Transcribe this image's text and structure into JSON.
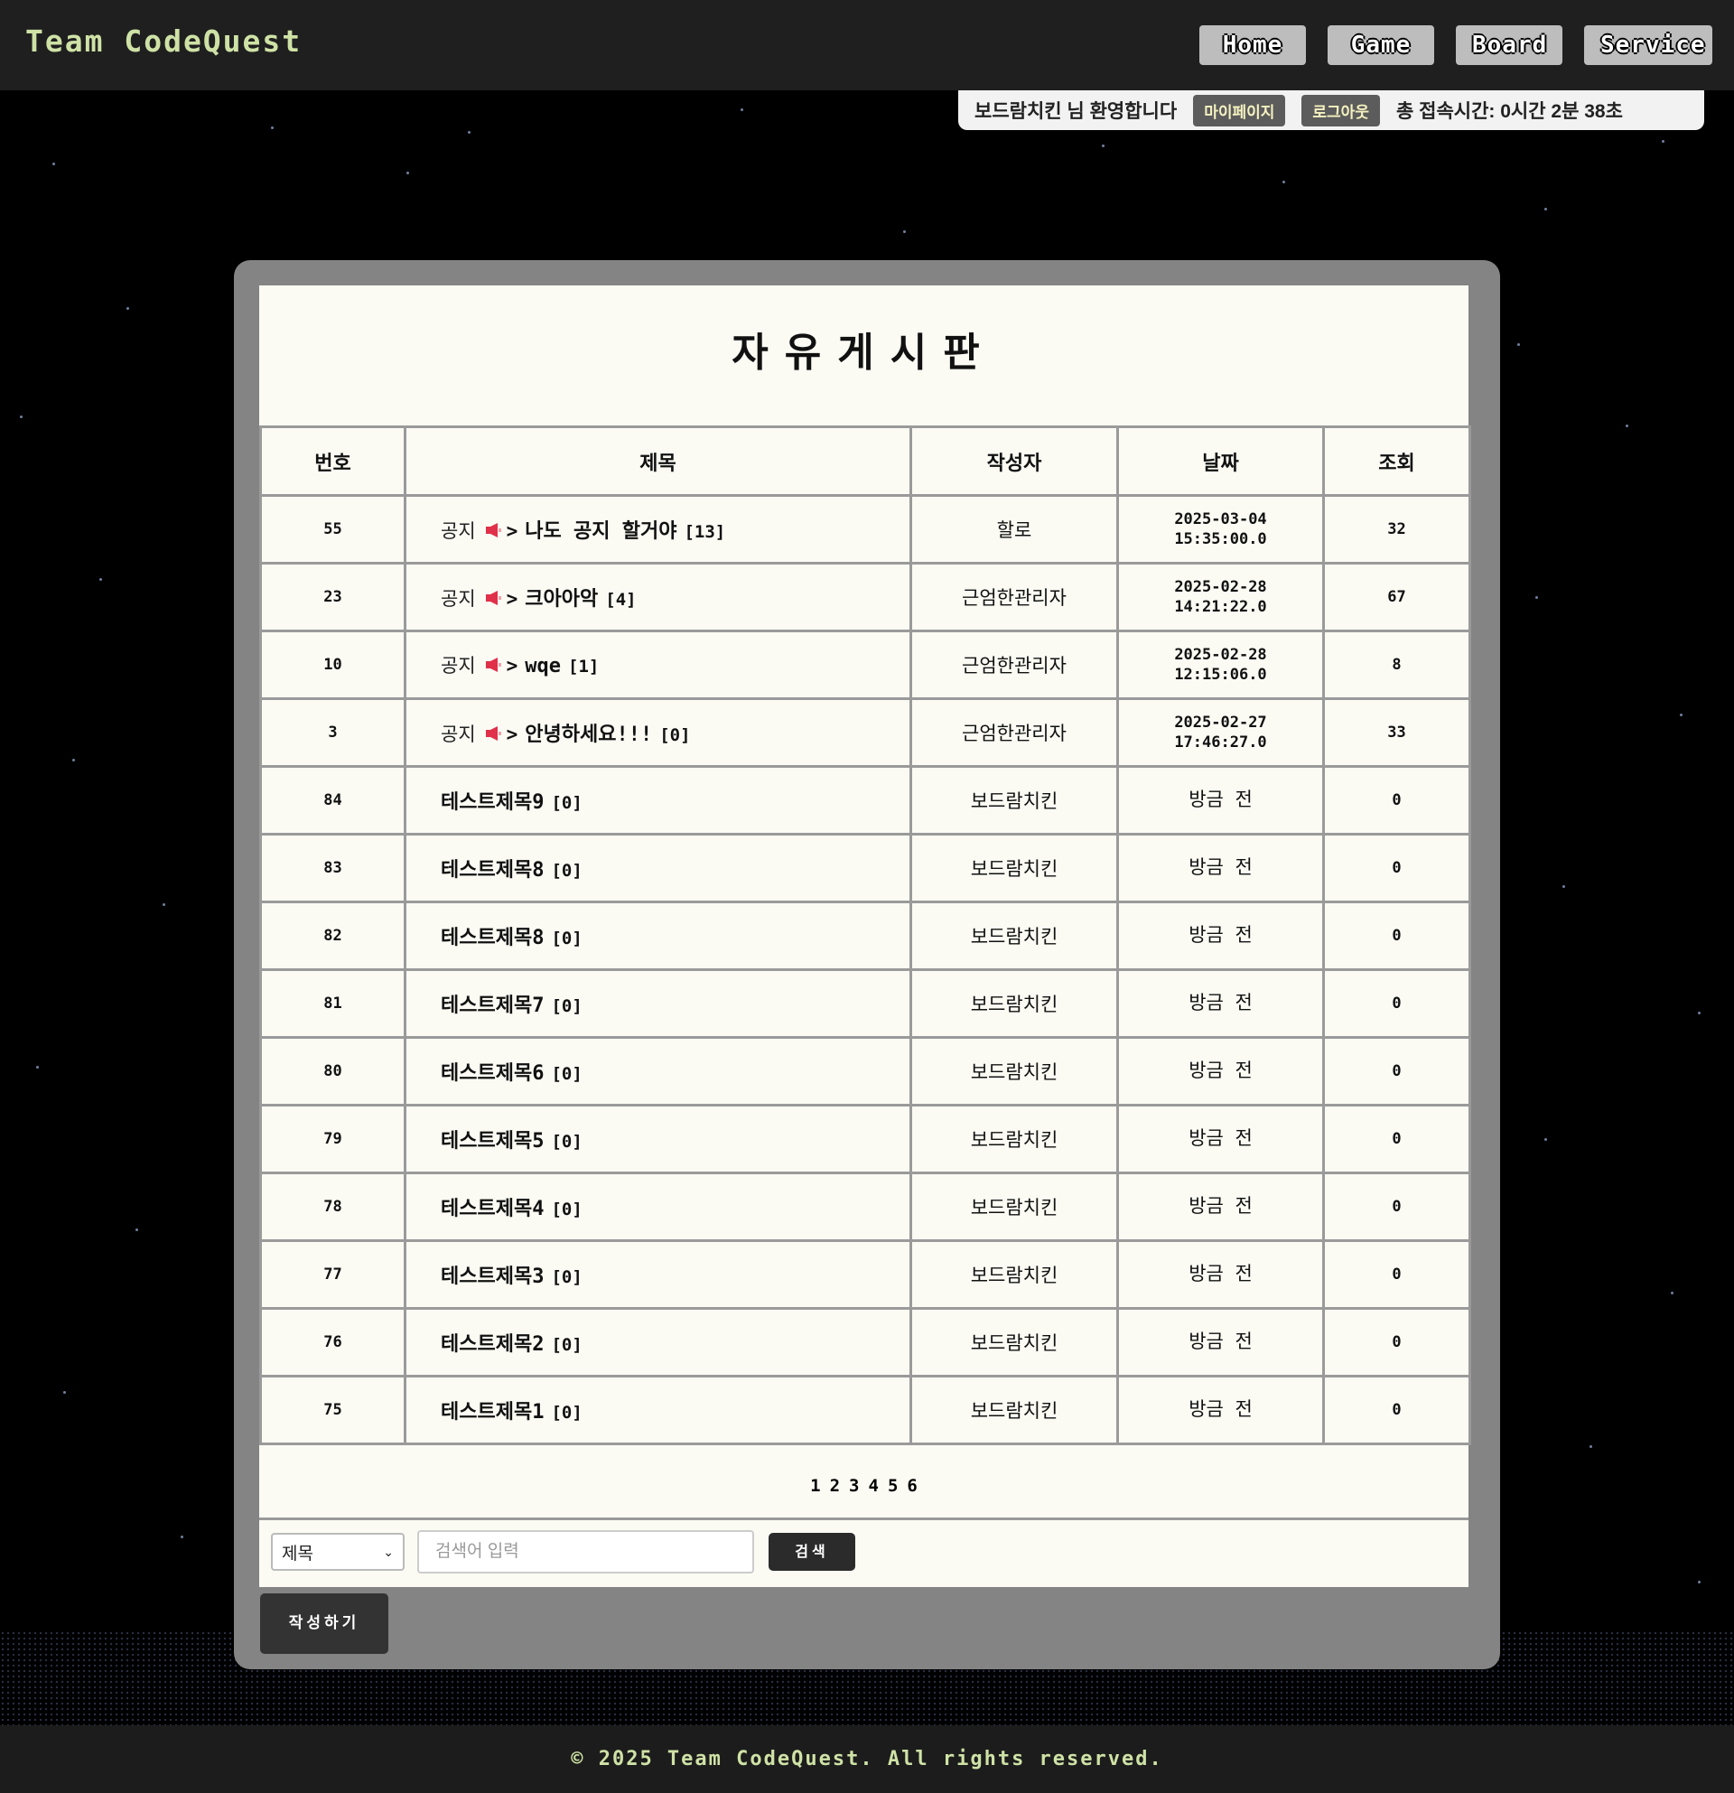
{
  "header": {
    "brand": "Team CodeQuest",
    "nav": [
      "Home",
      "Game",
      "Board",
      "Service"
    ]
  },
  "userbar": {
    "welcome": "보드람치킨 님 환영합니다",
    "mypage": "마이페이지",
    "logout": "로그아웃",
    "session_time": "총 접속시간: 0시간 2분 38초"
  },
  "board": {
    "title": "자유게시판",
    "columns": [
      "번호",
      "제목",
      "작성자",
      "날짜",
      "조회"
    ],
    "notice_label": "공지",
    "notice_arrow": ">",
    "rows": [
      {
        "no": "55",
        "notice": true,
        "title": "나도 공지 할거야",
        "comments": "[13]",
        "writer": "할로",
        "date1": "2025-03-04",
        "date2": "15:35:00.0",
        "views": "32"
      },
      {
        "no": "23",
        "notice": true,
        "title": "크아아악",
        "comments": "[4]",
        "writer": "근엄한관리자",
        "date1": "2025-02-28",
        "date2": "14:21:22.0",
        "views": "67"
      },
      {
        "no": "10",
        "notice": true,
        "title": "wqe",
        "comments": "[1]",
        "writer": "근엄한관리자",
        "date1": "2025-02-28",
        "date2": "12:15:06.0",
        "views": "8"
      },
      {
        "no": "3",
        "notice": true,
        "title": "안녕하세요!!!",
        "comments": "[0]",
        "writer": "근엄한관리자",
        "date1": "2025-02-27",
        "date2": "17:46:27.0",
        "views": "33"
      },
      {
        "no": "84",
        "notice": false,
        "title": "테스트제목9",
        "comments": "[0]",
        "writer": "보드람치킨",
        "date1": "방금 전",
        "date2": "",
        "views": "0"
      },
      {
        "no": "83",
        "notice": false,
        "title": "테스트제목8",
        "comments": "[0]",
        "writer": "보드람치킨",
        "date1": "방금 전",
        "date2": "",
        "views": "0"
      },
      {
        "no": "82",
        "notice": false,
        "title": "테스트제목8",
        "comments": "[0]",
        "writer": "보드람치킨",
        "date1": "방금 전",
        "date2": "",
        "views": "0"
      },
      {
        "no": "81",
        "notice": false,
        "title": "테스트제목7",
        "comments": "[0]",
        "writer": "보드람치킨",
        "date1": "방금 전",
        "date2": "",
        "views": "0"
      },
      {
        "no": "80",
        "notice": false,
        "title": "테스트제목6",
        "comments": "[0]",
        "writer": "보드람치킨",
        "date1": "방금 전",
        "date2": "",
        "views": "0"
      },
      {
        "no": "79",
        "notice": false,
        "title": "테스트제목5",
        "comments": "[0]",
        "writer": "보드람치킨",
        "date1": "방금 전",
        "date2": "",
        "views": "0"
      },
      {
        "no": "78",
        "notice": false,
        "title": "테스트제목4",
        "comments": "[0]",
        "writer": "보드람치킨",
        "date1": "방금 전",
        "date2": "",
        "views": "0"
      },
      {
        "no": "77",
        "notice": false,
        "title": "테스트제목3",
        "comments": "[0]",
        "writer": "보드람치킨",
        "date1": "방금 전",
        "date2": "",
        "views": "0"
      },
      {
        "no": "76",
        "notice": false,
        "title": "테스트제목2",
        "comments": "[0]",
        "writer": "보드람치킨",
        "date1": "방금 전",
        "date2": "",
        "views": "0"
      },
      {
        "no": "75",
        "notice": false,
        "title": "테스트제목1",
        "comments": "[0]",
        "writer": "보드람치킨",
        "date1": "방금 전",
        "date2": "",
        "views": "0"
      }
    ],
    "pages": [
      "1",
      "2",
      "3",
      "4",
      "5",
      "6"
    ]
  },
  "search": {
    "field_selected": "제목",
    "placeholder": "검색어 입력",
    "button": "검색"
  },
  "write_button": "작성하기",
  "footer": "© 2025 Team CodeQuest. All rights reserved.",
  "colors": {
    "brand": "#cfe2a6",
    "header_bg": "#1f1f1f",
    "panel": "#848484",
    "board_bg": "#fbfbf4",
    "megaphone": "#e0304a"
  }
}
